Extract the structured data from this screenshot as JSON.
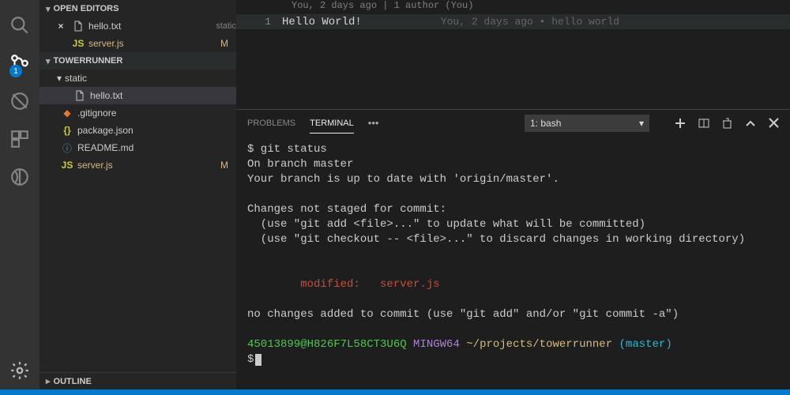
{
  "activity": {
    "scm_badge": "1"
  },
  "sidebar": {
    "open_editors_label": "OPEN EDITORS",
    "editors": [
      {
        "name": "hello.txt",
        "suffix": "static"
      },
      {
        "name": "server.js",
        "mark": "M"
      }
    ],
    "project_label": "TOWERRUNNER",
    "tree": {
      "folder1": "static",
      "folder1_file": "hello.txt",
      "files": [
        {
          "name": ".gitignore",
          "icon": "git"
        },
        {
          "name": "package.json",
          "icon": "braces"
        },
        {
          "name": "README.md",
          "icon": "info"
        },
        {
          "name": "server.js",
          "icon": "js",
          "mark": "M"
        }
      ]
    },
    "outline_label": "OUTLINE"
  },
  "editor": {
    "authorline": "You, 2 days ago | 1 author (You)",
    "line_no": "1",
    "content": "Hello World!",
    "codelens": "You, 2 days ago • hello world"
  },
  "panel": {
    "tabs": {
      "problems": "PROBLEMS",
      "terminal": "TERMINAL"
    },
    "terminal_select": "1: bash"
  },
  "terminal": {
    "l1": "$ git status",
    "l2": "On branch master",
    "l3": "Your branch is up to date with 'origin/master'.",
    "l4": "",
    "l5": "Changes not staged for commit:",
    "l6": "  (use \"git add <file>...\" to update what will be committed)",
    "l7": "  (use \"git checkout -- <file>...\" to discard changes in working directory)",
    "l8": "",
    "l9": "",
    "l10": "        modified:   server.js",
    "l11": "",
    "l12": "no changes added to commit (use \"git add\" and/or \"git commit -a\")",
    "l13": "",
    "prompt_user": "45013899@H826F7L58CT3U6Q",
    "prompt_env": "MINGW64",
    "prompt_path": "~/projects/towerrunner",
    "prompt_branch": "(master)",
    "prompt_ps": "$"
  }
}
